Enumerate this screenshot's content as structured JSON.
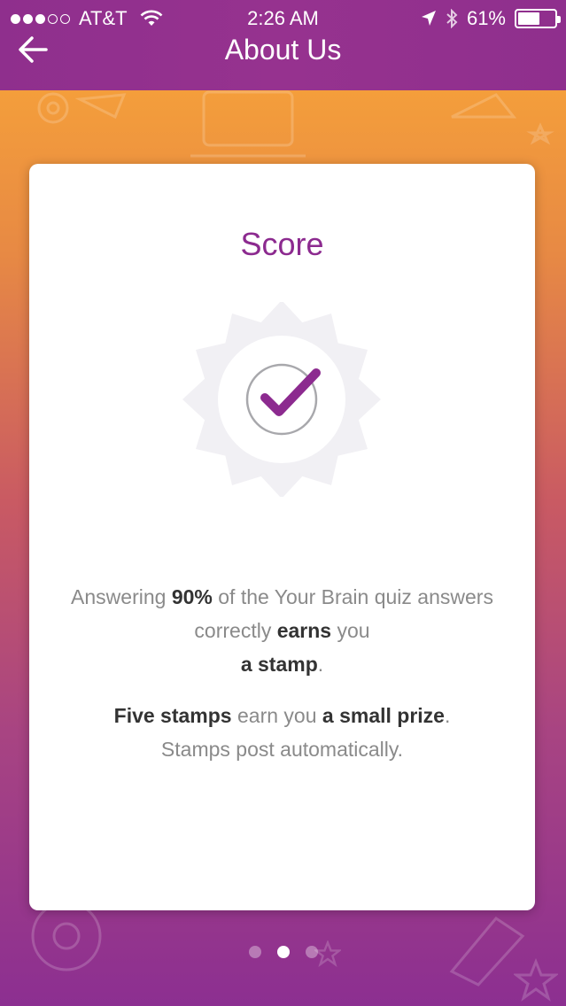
{
  "status_bar": {
    "carrier": "AT&T",
    "time": "2:26 AM",
    "battery": "61%",
    "battery_level": 0.61,
    "signal_bars_filled": 3,
    "signal_bars_total": 5
  },
  "header": {
    "title": "About Us",
    "back_icon": "arrow-left-icon"
  },
  "card": {
    "title": "Score",
    "icon": "checkmark-badge-icon",
    "paragraph1": {
      "t1": "Answering ",
      "b1": "90%",
      "t2": " of the Your Brain quiz answers correctly ",
      "b2": "earns",
      "t3": " you ",
      "b3": "a stamp",
      "t4": "."
    },
    "paragraph2": {
      "b1": "Five stamps",
      "t1": " earn you ",
      "b2": "a small prize",
      "t2": ".",
      "line2": "Stamps post automatically."
    }
  },
  "pager": {
    "total": 3,
    "active_index": 1
  },
  "colors": {
    "brand_purple": "#8c2a8f",
    "header_purple": "#96328f",
    "gradient_top": "#f49e3b",
    "gradient_bottom": "#8c2f91"
  }
}
